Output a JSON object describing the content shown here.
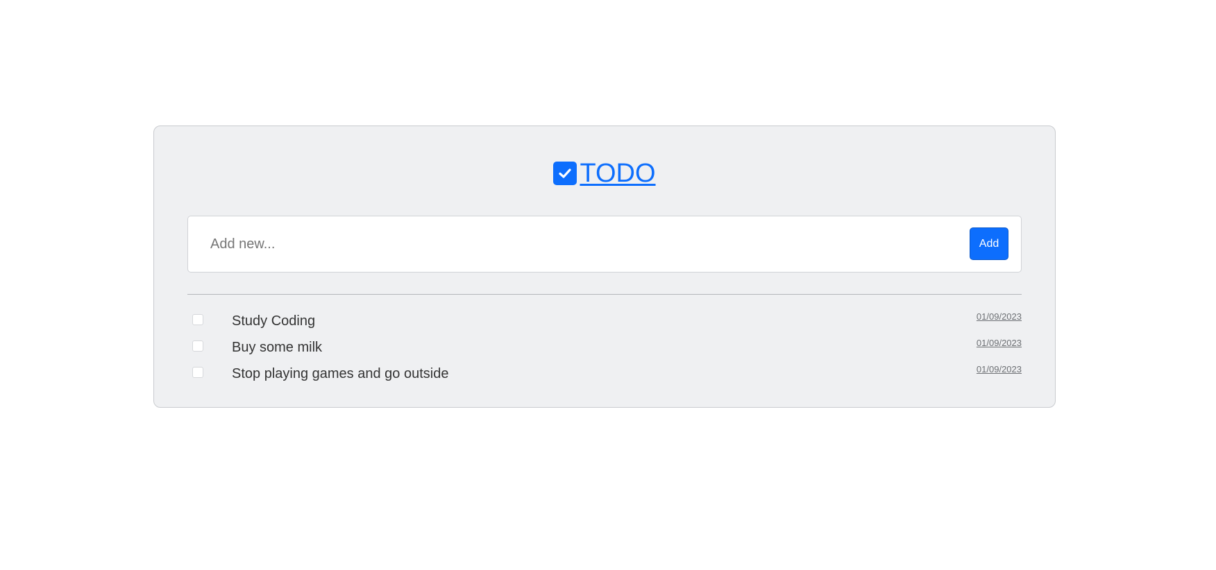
{
  "colors": {
    "accent": "#0d6efd",
    "card_background": "#eff0f2",
    "page_background": "#ffffff"
  },
  "header": {
    "icon": "check-square-icon",
    "title": "TODO"
  },
  "add_form": {
    "placeholder": "Add new...",
    "value": "",
    "button_label": "Add"
  },
  "todos": [
    {
      "text": "Study Coding",
      "date": "01/09/2023",
      "checked": false
    },
    {
      "text": "Buy some milk",
      "date": "01/09/2023",
      "checked": false
    },
    {
      "text": "Stop playing games and go outside",
      "date": "01/09/2023",
      "checked": false
    }
  ]
}
